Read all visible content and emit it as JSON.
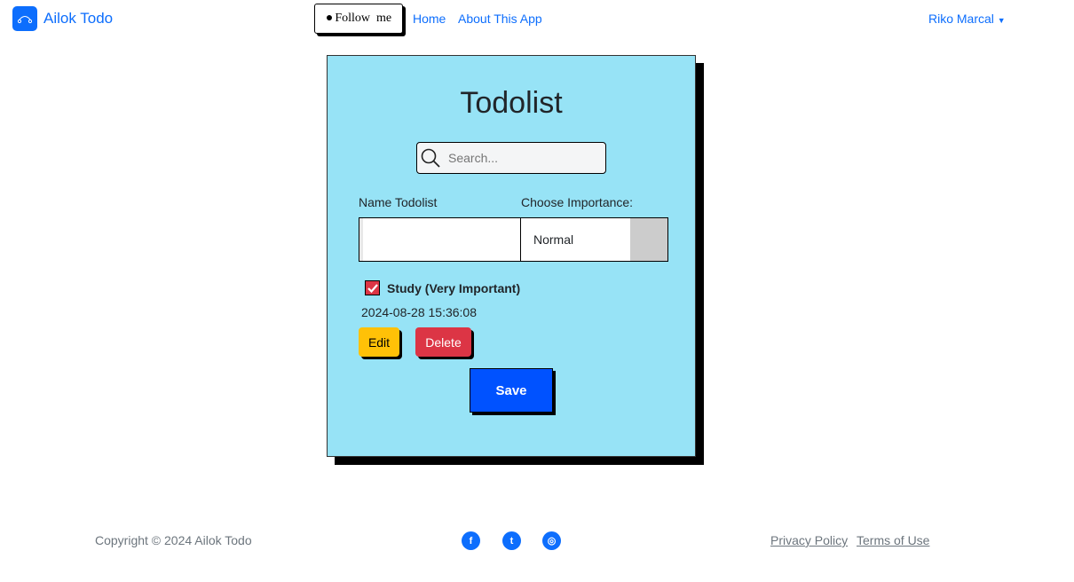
{
  "navbar": {
    "brand": "Ailok Todo",
    "follow": "Follow  me",
    "links": [
      "Home",
      "About This App"
    ],
    "user": "Riko Marcal"
  },
  "card": {
    "title": "Todolist",
    "search_placeholder": "Search...",
    "name_label": "Name Todolist",
    "importance_label": "Choose Importance:",
    "name_value": "",
    "importance_value": "Normal",
    "items": [
      {
        "text": "Study (Very Important)",
        "checked": true,
        "date": "2024-08-28 15:36:08",
        "edit": "Edit",
        "delete": "Delete"
      }
    ],
    "save": "Save"
  },
  "footer": {
    "copyright": "Copyright © 2024 Ailok Todo",
    "social": [
      "facebook-icon",
      "twitter-icon",
      "instagram-icon"
    ],
    "links": [
      "Privacy Policy",
      "Terms of Use"
    ]
  },
  "colors": {
    "card_bg": "#97e3f6",
    "primary": "#0d6efd",
    "save": "#0052ff",
    "edit": "#ffc107",
    "delete": "#dc3545"
  }
}
